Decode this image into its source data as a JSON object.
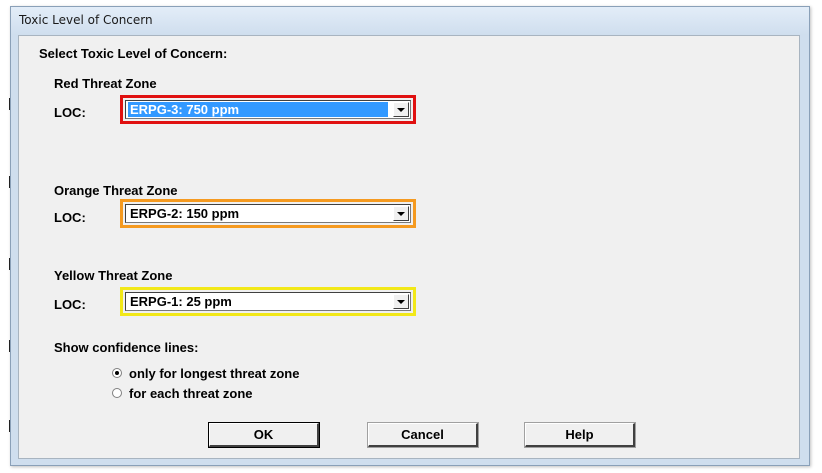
{
  "window": {
    "title": "Toxic Level of Concern"
  },
  "dialog": {
    "heading": "Select Toxic Level of Concern:",
    "zones": [
      {
        "label": "Red Threat Zone",
        "loc_label": "LOC:",
        "value": "ERPG-3: 750 ppm",
        "border_color": "#e01010",
        "selected": true
      },
      {
        "label": "Orange Threat Zone",
        "loc_label": "LOC:",
        "value": "ERPG-2: 150 ppm",
        "border_color": "#f59a20",
        "selected": false
      },
      {
        "label": "Yellow Threat Zone",
        "loc_label": "LOC:",
        "value": "ERPG-1: 25 ppm",
        "border_color": "#f2e818",
        "selected": false
      }
    ],
    "confidence": {
      "label": "Show confidence lines:",
      "options": [
        {
          "label": "only for longest threat zone",
          "checked": true
        },
        {
          "label": "for each threat zone",
          "checked": false
        }
      ]
    },
    "buttons": {
      "ok": "OK",
      "cancel": "Cancel",
      "help": "Help"
    }
  }
}
